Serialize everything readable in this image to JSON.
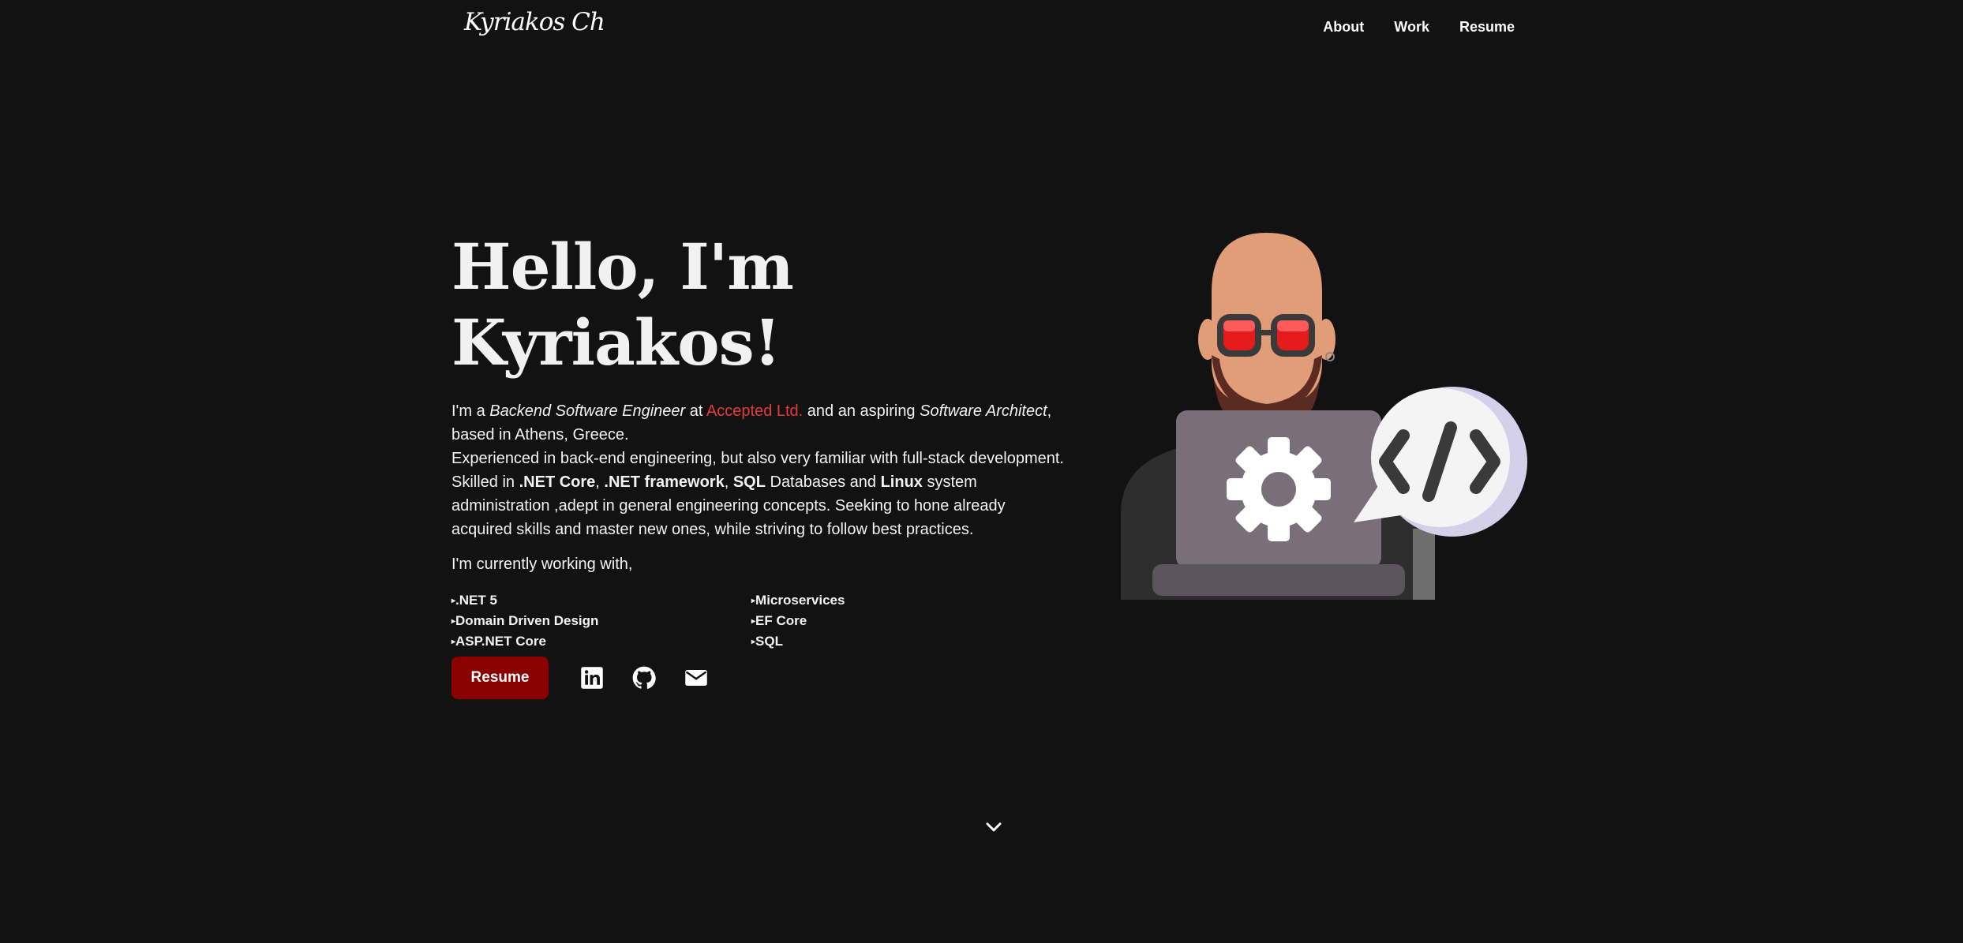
{
  "header": {
    "logo": "Kyriakos Ch",
    "nav": [
      "About",
      "Work",
      "Resume"
    ]
  },
  "hero": {
    "title": "Hello, I'm Kyriakos!",
    "bio": {
      "p1_a": "I'm a ",
      "p1_role": "Backend Software Engineer",
      "p1_b": " at ",
      "p1_company": "Accepted Ltd.",
      "p1_c": " and an aspiring ",
      "p1_aspire": "Software Architect",
      "p1_d": ", based in Athens, Greece.",
      "p2": "Experienced in back-end engineering, but also very familiar with full-stack development.",
      "p3_a": "Skilled in ",
      "p3_s1": ".NET Core",
      "p3_b": ", ",
      "p3_s2": ".NET framework",
      "p3_c": ", ",
      "p3_s3": "SQL",
      "p3_d": " Databases and ",
      "p3_s4": "Linux",
      "p3_e": " system administration ,adept in general engineering concepts. Seeking to hone already acquired skills and master new ones, while striving to follow best practices."
    },
    "working_with_label": "I'm currently working with,",
    "skills": [
      ".NET 5",
      "Microservices",
      "Domain Driven Design",
      "EF Core",
      "ASP.NET Core",
      "SQL"
    ]
  },
  "actions": {
    "resume_label": "Resume",
    "social_icons": [
      "linkedin-icon",
      "github-icon",
      "mail-icon"
    ]
  },
  "colors": {
    "background": "#121212",
    "accent": "#8b0000",
    "company_link": "#e63a3a"
  }
}
